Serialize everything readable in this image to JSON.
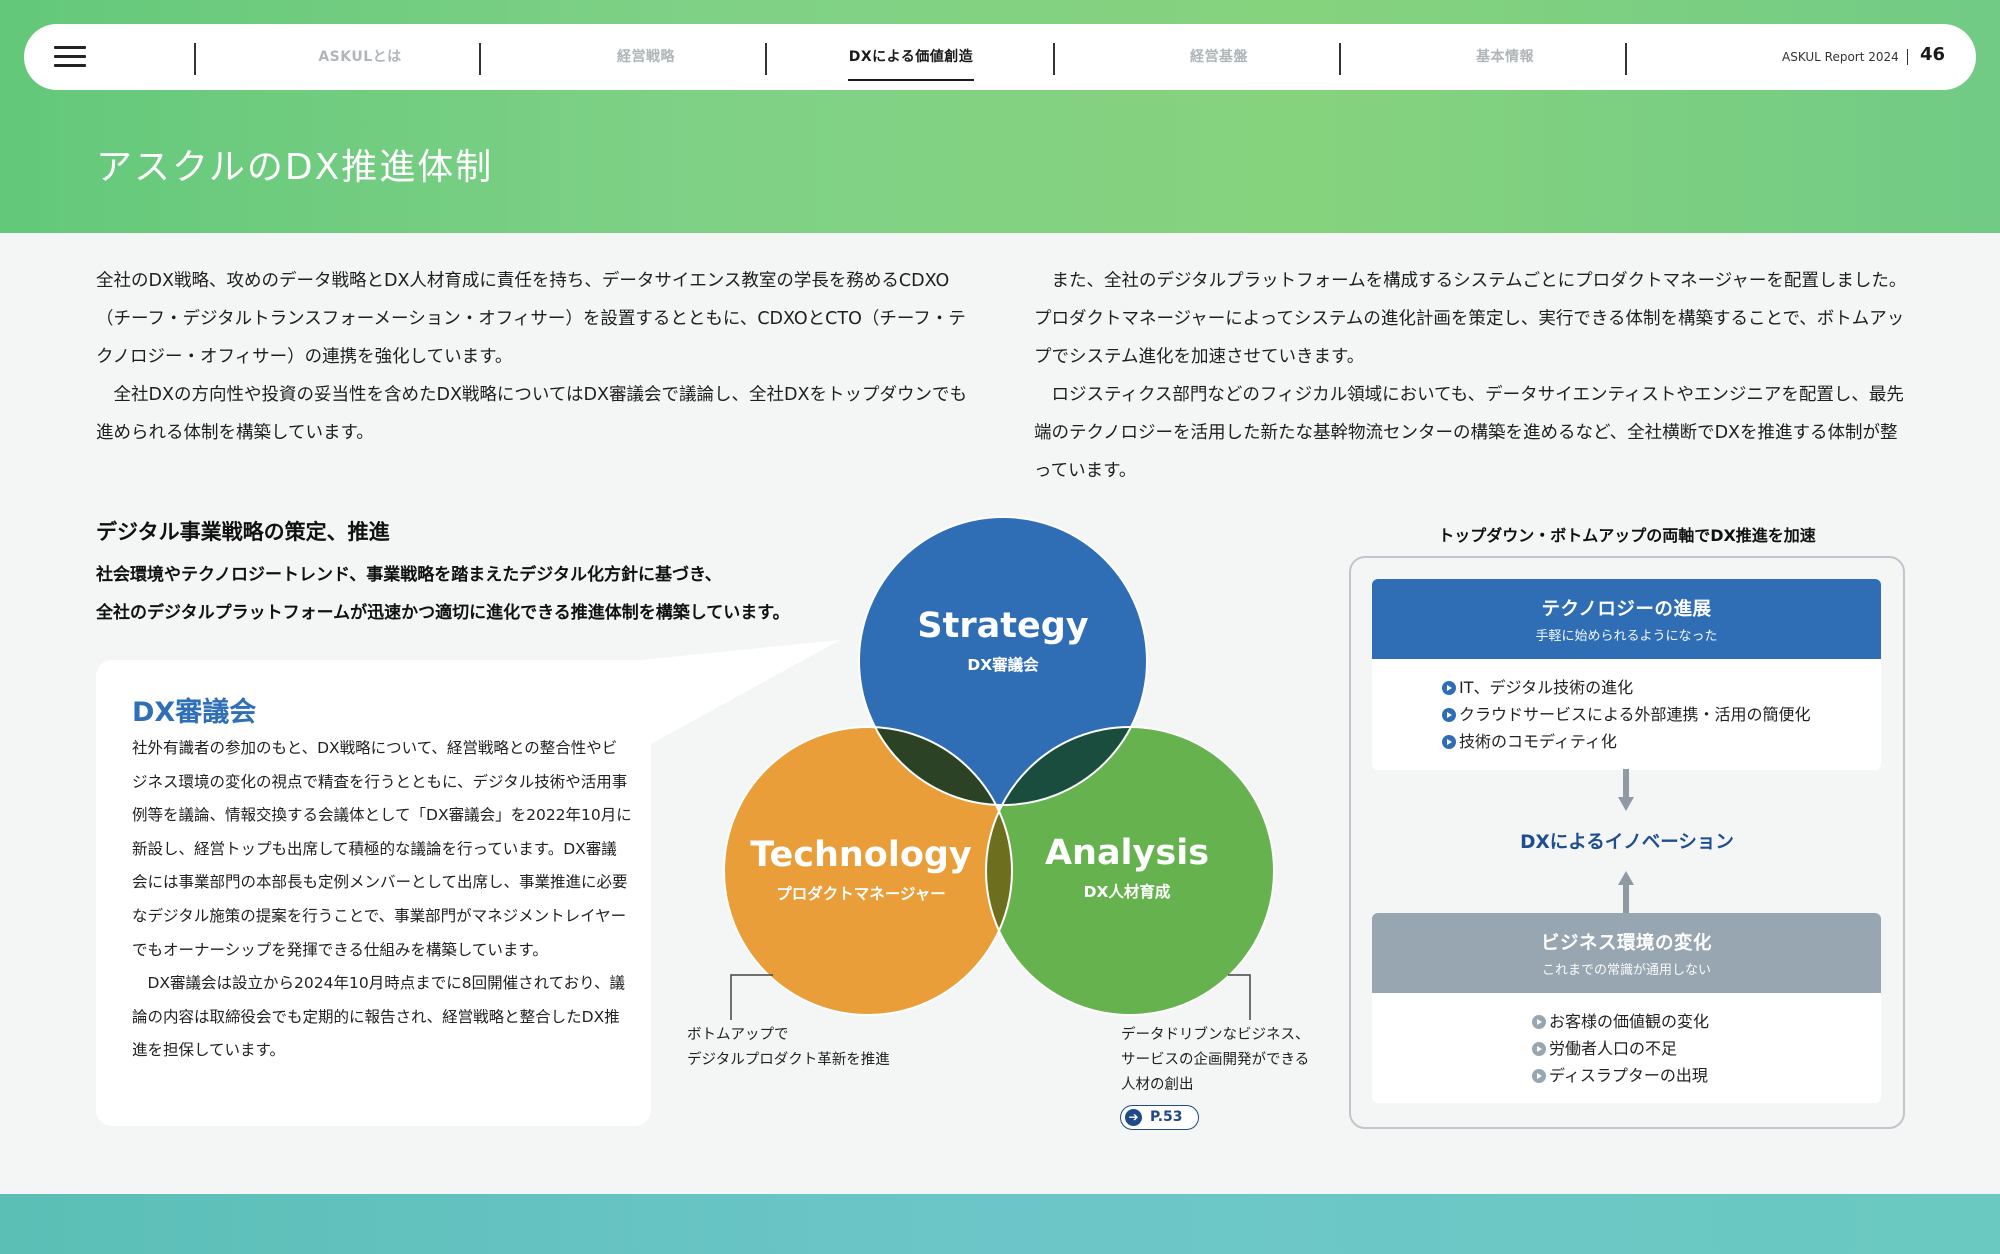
{
  "nav": {
    "items": [
      "ASKULとは",
      "経営戦略",
      "DXによる価値創造",
      "経営基盤",
      "基本情報"
    ],
    "active_index": 2,
    "report": "ASKUL Report 2024",
    "page": "46"
  },
  "page": {
    "title": "アスクルのDX推進体制"
  },
  "intro": {
    "left": [
      "全社のDX戦略、攻めのデータ戦略とDX人材育成に責任を持ち、データサイエンス教室の学長を務めるCDXO（チーフ・デジタルトランスフォーメーション・オフィサー）を設置するとともに、CDXOとCTO（チーフ・テクノロジー・オフィサー）の連携を強化しています。",
      "全社DXの方向性や投資の妥当性を含めたDX戦略についてはDX審議会で議論し、全社DXをトップダウンでも進められる体制を構築しています。"
    ],
    "right": [
      "また、全社のデジタルプラットフォームを構成するシステムごとにプロダクトマネージャーを配置しました。プロダクトマネージャーによってシステムの進化計画を策定し、実行できる体制を構築することで、ボトムアップでシステム進化を加速させていきます。",
      "ロジスティクス部門などのフィジカル領域においても、データサイエンティストやエンジニアを配置し、最先端のテクノロジーを活用した新たな基幹物流センターの構築を進めるなど、全社横断でDXを推進する体制が整っています。"
    ]
  },
  "section": {
    "heading": "デジタル事業戦略の策定、推進",
    "sub_line1": "社会環境やテクノロジートレンド、事業戦略を踏まえたデジタル化方針に基づき、",
    "sub_line2": "全社のデジタルプラットフォームが迅速かつ適切に進化できる推進体制を構築しています。"
  },
  "card": {
    "title": "DX審議会",
    "paragraphs": [
      "社外有識者の参加のもと、DX戦略について、経営戦略との整合性やビジネス環境の変化の視点で精査を行うとともに、デジタル技術や活用事例等を議論、情報交換する会議体として「DX審議会」を2022年10月に新設し、経営トップも出席して積極的な議論を行っています。DX審議会には事業部門の本部長も定例メンバーとして出席し、事業推進に必要なデジタル施策の提案を行うことで、事業部門がマネジメントレイヤーでもオーナーシップを発揮できる仕組みを構築しています。",
      "DX審議会は設立から2024年10月時点までに8回開催されており、議論の内容は取締役会でも定期的に報告され、経営戦略と整合したDX推進を担保しています。"
    ]
  },
  "venn": {
    "strategy": {
      "label": "Strategy",
      "sub": "DX審議会",
      "color": "#2f6db5"
    },
    "technology": {
      "label": "Technology",
      "sub": "プロダクトマネージャー",
      "color": "#e99e3a"
    },
    "analysis": {
      "label": "Analysis",
      "sub": "DX人材育成",
      "color": "#66b24e"
    },
    "note_left": [
      "ボトムアップで",
      "デジタルプロダクト革新を推進"
    ],
    "note_right": [
      "データドリブンなビジネス、",
      "サービスの企画開発ができる",
      "人材の創出"
    ],
    "ref": "P.53"
  },
  "right": {
    "title": "トップダウン・ボトムアップの両軸でDX推進を加速",
    "tech_box": {
      "title": "テクノロジーの進展",
      "sub": "手軽に始められるようになった",
      "items": [
        "IT、デジタル技術の進化",
        "クラウドサービスによる外部連携・活用の簡便化",
        "技術のコモディティ化"
      ],
      "color": "#2f6db5"
    },
    "innovation": "DXによるイノベーション",
    "biz_box": {
      "title": "ビジネス環境の変化",
      "sub": "これまでの常識が通用しない",
      "items": [
        "お客様の価値観の変化",
        "労働者人口の不足",
        "ディスラプターの出現"
      ],
      "color": "#97a6b0"
    }
  }
}
